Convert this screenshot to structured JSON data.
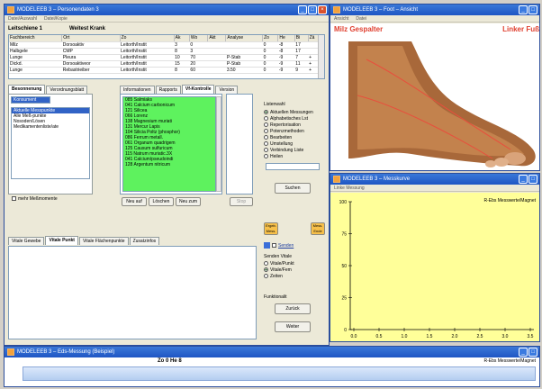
{
  "main_window": {
    "title": "MODELEEB 3 – Personendaten 3",
    "menu": [
      "Datei/Auswahl",
      "Datei/Kopie"
    ],
    "header_left": "Leitschiene 1",
    "header_right": "Weitest Krank",
    "table": {
      "columns": [
        "Fachbereich",
        "Ort",
        "Zo",
        "Ak",
        "Wo",
        "Akt",
        "Analyse",
        "Zo",
        "He",
        "Bi",
        "Zä"
      ],
      "rows": [
        [
          "Milz",
          "Dorsoaktiv",
          "Leitorth/Instit",
          "3",
          "0",
          "",
          "",
          "0",
          "-8",
          "17",
          ""
        ],
        [
          "Halbgele",
          "CMP",
          "Leitorth/Instit",
          "8",
          "3",
          "",
          "",
          "0",
          "-8",
          "17",
          ""
        ],
        [
          "Lunge",
          "Pleura",
          "Leitorth/Instit",
          "10",
          "70",
          "",
          "P-Stab",
          "0",
          "-9",
          "7",
          "+"
        ],
        [
          "Dickd.",
          "Dorsoaktiveor",
          "Leitorth/Instit",
          "15",
          "20",
          "",
          "P-Stab",
          "0",
          "-9",
          "11",
          "+"
        ],
        [
          "Lunge",
          "Rebastrieiber",
          "Leitorth/Instit",
          "8",
          "60",
          "",
          "3.50",
          "0",
          "-9",
          "9",
          "+"
        ]
      ]
    },
    "tabs_left": [
      "Besonnenung",
      "Verordnungsblatt"
    ],
    "tabs_mid": [
      "Informationen",
      "Rapports",
      "Vf-Kontrolle",
      "Version"
    ],
    "dropdown_value": "Konsument",
    "left_list": [
      "Aktuelle Messpunkte",
      "Alle Meß-punkte",
      "Nosoden/Lösen",
      "Medikamentenliste/ate"
    ],
    "green_list": [
      "085 Salmiaks",
      "041 Calcium carbonicum",
      "121 Silicea",
      "066 Lorenz",
      "138 Magnesium muriati",
      "131 Mercur Lapis",
      "104 Silicia Poltz (phosphor)",
      "086 Ferrum metall.",
      "061 Organum quadrigem",
      "125 Causum sulfuricum",
      "115 Natrum muriatic.3X",
      "041 Calcium/pseudoindi",
      "128 Argentum nitricum"
    ],
    "include_checkbox_label": "mehr Meßmomente",
    "buttons_row": [
      "Neu auf",
      "Löschen",
      "Neu zum",
      "Stop"
    ],
    "side_title": "Listenwahl",
    "side_options": [
      "Aktuellen Messungen",
      "Alphabetisches Lst",
      "Repertorisation",
      "Potenzmethoden",
      "Bearbeiten",
      "Umstellung",
      "Verbindung Liste",
      "Heilen"
    ],
    "side_options_selected": 0,
    "search_label": "Suchen",
    "small_btn1": "Ergeb. Mess.",
    "small_btn2": "Mess. Ende",
    "senden_label": "Senden",
    "senden_vhb_title": "Senden Vitale",
    "senden_vhb_opts": [
      "Vitale/Punkt",
      "Vitale/Fem",
      "Zeiten"
    ],
    "senden_vhb_selected": 1,
    "kontrolle_title": "Funktionalit",
    "btn_zurueck": "Zurück",
    "btn_weiter": "Weiter",
    "bottom_tabs": [
      "Vitale Gewebe",
      "Vitale Punkt",
      "Vitale Flächenpunkte",
      "Zusatzinfos"
    ]
  },
  "foot_window": {
    "title": "MODELEEB 3 – Foot – Ansicht",
    "menu": [
      "Ansicht",
      "Datei"
    ],
    "label_left": "Milz Gespalter",
    "label_right": "Linker Fuß"
  },
  "chart_window": {
    "title": "MODELEEB 3 – Messkurve",
    "menu_label": "Linke Messung",
    "legend": "R-Ebs Messwerte/Magnet",
    "chart_data": {
      "type": "line",
      "x_ticks": [
        "0.0",
        "0.5",
        "1.0",
        "1.5",
        "2.0",
        "2.5",
        "3.0",
        "3.5"
      ],
      "y_ticks": [
        "100",
        "75",
        "50",
        "25",
        "0"
      ],
      "xlabel": "",
      "ylabel": "",
      "ylim": [
        0,
        100
      ],
      "xlim": [
        0,
        3.5
      ],
      "series": [
        {
          "values": []
        }
      ],
      "background": "#ffff99"
    }
  },
  "bottom_window": {
    "title": "MODELEEB 3 – Eds-Messung (Beispiel)",
    "center_label": "Zo 0 He 8",
    "right_label": "R-Ebs Messwerte/Magnet"
  }
}
